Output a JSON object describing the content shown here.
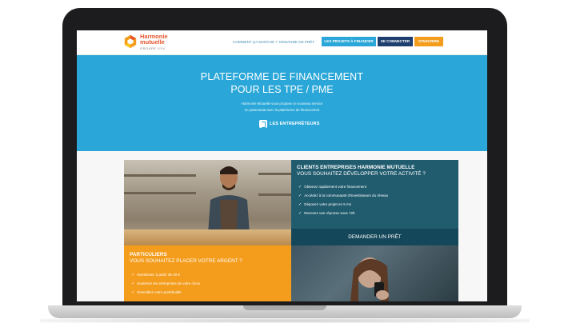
{
  "brand": {
    "name_line1": "Harmonie",
    "name_line2": "mutuelle",
    "group_line": "GROUPE VYV",
    "colors": {
      "orange": "#f49c1c",
      "blue": "#2aa7d8",
      "dark_teal": "#205b6e",
      "navy": "#1f3f6e",
      "dark": "#1c1c1e"
    }
  },
  "nav": {
    "link1": "COMMENT ÇA MARCHE ?",
    "link2": "DEMANDE DE PRÊT",
    "btn_projects": "LES PROJETS À FINANCER",
    "btn_login": "SE CONNECTER",
    "btn_signup": "S'INSCRIRE"
  },
  "hero": {
    "title_line1": "PLATEFORME DE FINANCEMENT",
    "title_line2": "POUR LES TPE / PME",
    "desc_line1": "Harmonie Mutuelle vous propose ce nouveau service",
    "desc_line2": "en partenariat avec la plateforme de financement",
    "partner_name": "LES ENTREPRÊTEURS",
    "partner_icon": "entrepreteurs-logo-icon"
  },
  "business": {
    "title": "CLIENTS ENTREPRISES HARMONIE MUTUELLE",
    "subtitle": "VOUS SOUHAITEZ DÉVELOPPER VOTRE ACTIVITÉ ?",
    "items": [
      "Obtenez rapidement votre financement",
      "Accédez à la communauté d'investisseurs du réseau",
      "Déposez votre projet en 5 mn",
      "Recevez une réponse sous 72h"
    ],
    "cta": "DEMANDER UN PRÊT"
  },
  "individuals": {
    "title": "PARTICULIERS",
    "subtitle": "VOUS SOUHAITEZ PLACER VOTRE ARGENT ?",
    "items": [
      "Investissez à partir de 20 €",
      "Soutenez les entreprises de votre choix",
      "Diversifiez votre portefeuille"
    ]
  }
}
